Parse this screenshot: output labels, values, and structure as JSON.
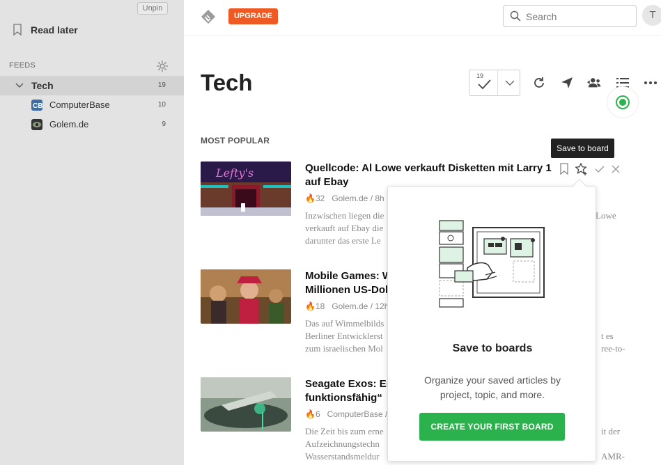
{
  "sidebar": {
    "unpin_label": "Unpin",
    "read_later_label": "Read later",
    "feeds_label": "FEEDS",
    "tech": {
      "label": "Tech",
      "count": "19"
    },
    "feeds": [
      {
        "label": "ComputerBase",
        "count": "10",
        "icon": "computerbase-icon"
      },
      {
        "label": "Golem.de",
        "count": "9",
        "icon": "golem-icon"
      }
    ]
  },
  "topbar": {
    "upgrade_label": "UPGRADE",
    "search_placeholder": "Search",
    "avatar_letter": "T"
  },
  "header": {
    "title": "Tech",
    "unread_count": "19"
  },
  "section_label": "MOST POPULAR",
  "tooltip": "Save to board",
  "articles": [
    {
      "title": "Quellcode: Al Lowe verkauft Disketten mit Larry 1 auf Ebay",
      "engagement": "32",
      "source": "Golem.de / 8h",
      "snippet_lines": [
        "Inzwischen liegen die",
        "verkauft auf Ebay die",
        "darunter das erste Le"
      ],
      "tail": "Lowe"
    },
    {
      "title_lines": [
        "Mobile Games: W",
        "Millionen US-Dol"
      ],
      "engagement": "18",
      "source": "Golem.de / 12h",
      "snippet_lines": [
        "Das auf Wimmelbilds",
        "Berliner Entwicklerst",
        "zum israelischen Mol"
      ],
      "tail_lines": [
        "t es",
        "ree-to-"
      ]
    },
    {
      "title_lines": [
        "Seagate Exos: Er",
        "funktionsfähig“"
      ],
      "engagement": "6",
      "source": "ComputerBase / ",
      "snippet_lines": [
        "Die Zeit bis zum erne",
        "Aufzeichnungstechn",
        "Wasserstandsmeldur"
      ],
      "tail_lines": [
        "it der",
        "AMR-"
      ]
    }
  ],
  "popup": {
    "title": "Save to boards",
    "description": "Organize your saved articles by project, topic, and more.",
    "button_label": "CREATE YOUR FIRST BOARD"
  },
  "colors": {
    "accent_green": "#2bb24c",
    "upgrade_orange": "#ee5a23",
    "sidebar_bg": "#e3e3e3"
  }
}
